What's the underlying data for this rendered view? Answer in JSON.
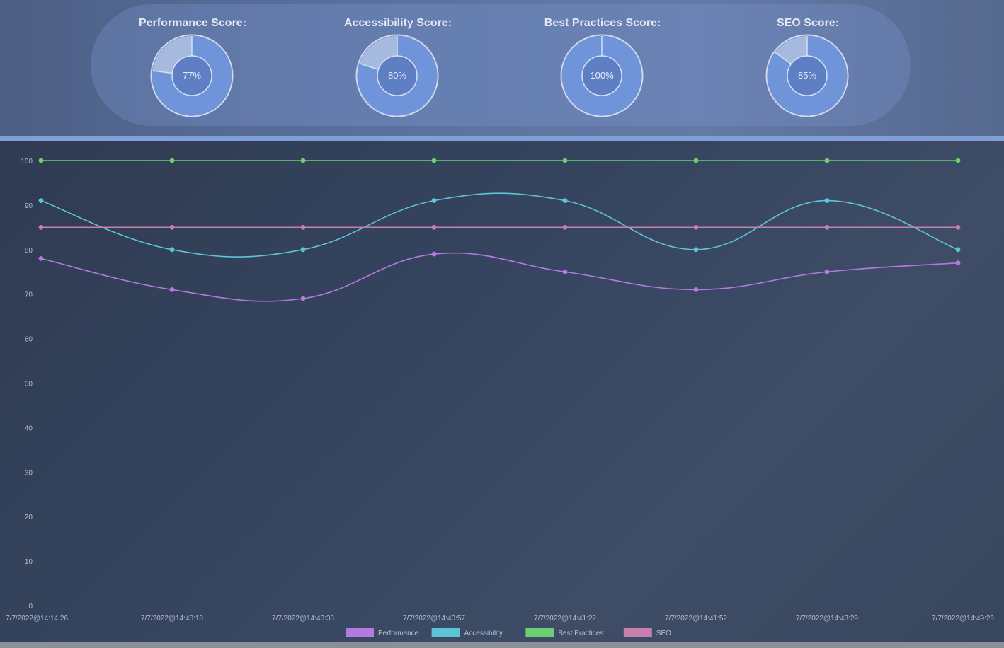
{
  "scores": [
    {
      "title": "Performance Score:",
      "value": 77,
      "label": "77%"
    },
    {
      "title": "Accessibility Score:",
      "value": 80,
      "label": "80%"
    },
    {
      "title": "Best Practices Score:",
      "value": 100,
      "label": "100%"
    },
    {
      "title": "SEO Score:",
      "value": 85,
      "label": "85%"
    }
  ],
  "colors": {
    "donut_fill": "#6f94da",
    "donut_rest": "#a6badf",
    "performance": "#b47ae0",
    "accessibility": "#5fc3d6",
    "best_practices": "#6ccf72",
    "seo": "#c77fae",
    "tick_text": "#b5bfcf"
  },
  "chart_data": {
    "type": "line",
    "title": "",
    "xlabel": "",
    "ylabel": "",
    "ylim": [
      0,
      100
    ],
    "yticks": [
      0,
      10,
      20,
      30,
      40,
      50,
      60,
      70,
      80,
      90,
      100
    ],
    "categories": [
      "7/7/2022@14:14:26",
      "7/7/2022@14:40:18",
      "7/7/2022@14:40:38",
      "7/7/2022@14:40:57",
      "7/7/2022@14:41:22",
      "7/7/2022@14:41:52",
      "7/7/2022@14:43:29",
      "7/7/2022@14:49:26"
    ],
    "series": [
      {
        "name": "Performance",
        "color": "#b47ae0",
        "values": [
          78,
          71,
          69,
          79,
          75,
          71,
          75,
          77
        ]
      },
      {
        "name": "Accessibility",
        "color": "#5fc3d6",
        "values": [
          91,
          80,
          80,
          91,
          91,
          80,
          91,
          80
        ]
      },
      {
        "name": "Best Practices",
        "color": "#6ccf72",
        "values": [
          100,
          100,
          100,
          100,
          100,
          100,
          100,
          100
        ]
      },
      {
        "name": "SEO",
        "color": "#c77fae",
        "values": [
          85,
          85,
          85,
          85,
          85,
          85,
          85,
          85
        ]
      }
    ],
    "grid": false,
    "legend_position": "bottom"
  }
}
